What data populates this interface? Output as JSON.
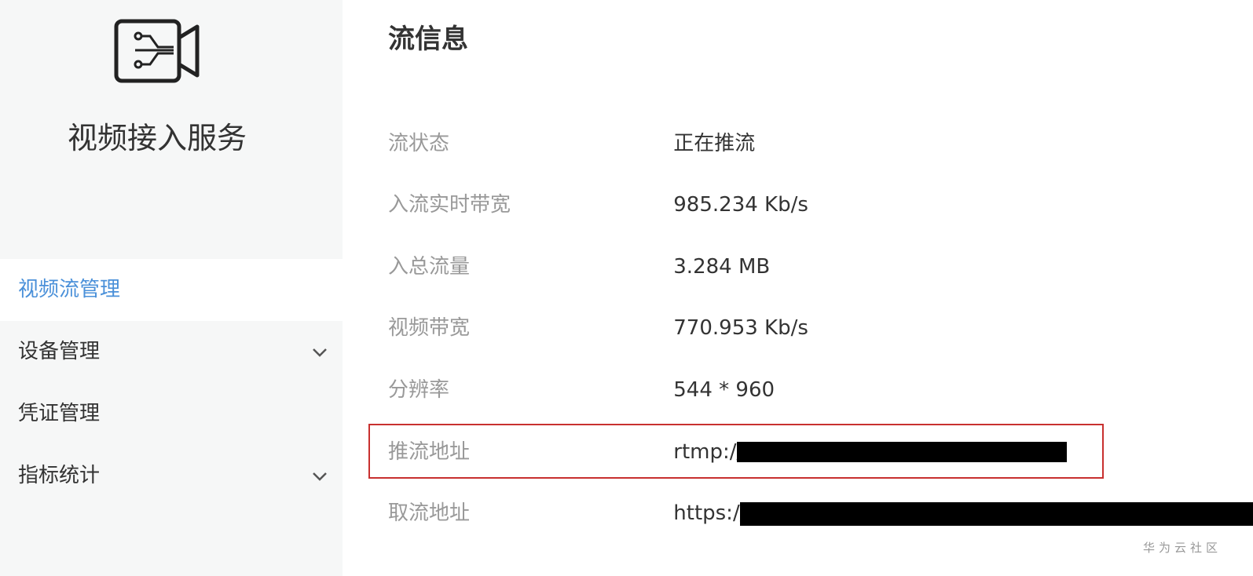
{
  "sidebar": {
    "logo_icon": "video-camera-network-icon",
    "service_title": "视频接入服务",
    "menu": [
      {
        "label": "视频流管理",
        "active": true,
        "has_chevron": false
      },
      {
        "label": "设备管理",
        "active": false,
        "has_chevron": true
      },
      {
        "label": "凭证管理",
        "active": false,
        "has_chevron": false
      },
      {
        "label": "指标统计",
        "active": false,
        "has_chevron": true
      }
    ]
  },
  "main": {
    "section_title": "流信息",
    "rows": [
      {
        "label": "流状态",
        "value": "正在推流"
      },
      {
        "label": "入流实时带宽",
        "value": "985.234 Kb/s"
      },
      {
        "label": "入总流量",
        "value": "3.284 MB"
      },
      {
        "label": "视频带宽",
        "value": "770.953 Kb/s"
      },
      {
        "label": "分辨率",
        "value": "544 * 960"
      },
      {
        "label": "推流地址",
        "value": "rtmp://"
      },
      {
        "label": "取流地址",
        "value": "https://"
      }
    ]
  },
  "colors": {
    "accent": "#4a90d9",
    "highlight_border": "#c8302f",
    "sidebar_bg": "#f6f7f7"
  },
  "watermark": "华为云社区"
}
